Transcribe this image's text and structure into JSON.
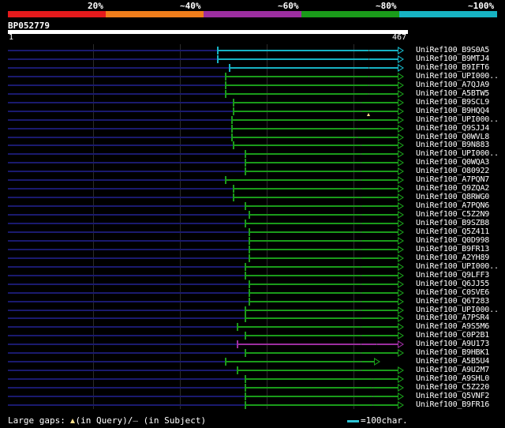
{
  "legend": [
    {
      "label": "20%",
      "color": "#e41a1c"
    },
    {
      "label": "~40%",
      "color": "#f07d1b"
    },
    {
      "label": "~60%",
      "color": "#9c2ea0"
    },
    {
      "label": "~80%",
      "color": "#1a9b1a"
    },
    {
      "label": "~100%",
      "color": "#17b3c3"
    }
  ],
  "query": {
    "id": "BP052779",
    "start": "1",
    "end": "467"
  },
  "colors": {
    "query_line": "#1a1a6e",
    "gap_marker": "#ffe08a",
    "ticks": "#555555"
  },
  "hits": [
    {
      "name": "UniRef100_B9S0A5",
      "start": 0.53,
      "identity": "~100%",
      "ticks": [
        0.91
      ]
    },
    {
      "name": "UniRef100_B9MTJ4",
      "start": 0.53,
      "identity": "~100%",
      "ticks": [
        0.91
      ]
    },
    {
      "name": "UniRef100_B9IFT6",
      "start": 0.56,
      "identity": "~100%",
      "ticks": [
        0.91
      ]
    },
    {
      "name": "UniRef100_UPI000..",
      "start": 0.55,
      "identity": "~80%",
      "ticks": [
        0.91
      ]
    },
    {
      "name": "UniRef100_A7QJA9",
      "start": 0.55,
      "identity": "~80%",
      "ticks": [
        0.91
      ]
    },
    {
      "name": "UniRef100_A5BTW5",
      "start": 0.55,
      "identity": "~80%",
      "ticks": [
        0.91
      ]
    },
    {
      "name": "UniRef100_B9SCL9",
      "start": 0.57,
      "identity": "~80%",
      "ticks": [
        0.89
      ]
    },
    {
      "name": "UniRef100_B9HQQ4",
      "start": 0.57,
      "identity": "~80%",
      "ticks": [
        0.89
      ],
      "gap_marker": 0.91
    },
    {
      "name": "UniRef100_UPI000..",
      "start": 0.565,
      "identity": "~80%",
      "ticks": [
        0.88
      ]
    },
    {
      "name": "UniRef100_Q9SJJ4",
      "start": 0.565,
      "identity": "~80%",
      "ticks": [
        0.88
      ]
    },
    {
      "name": "UniRef100_Q0WVL8",
      "start": 0.565,
      "identity": "~80%",
      "ticks": [
        0.88
      ]
    },
    {
      "name": "UniRef100_B9N883",
      "start": 0.57,
      "identity": "~80%",
      "ticks": [
        0.89
      ]
    },
    {
      "name": "UniRef100_UPI000..",
      "start": 0.6,
      "identity": "~80%",
      "ticks": [
        0.89
      ]
    },
    {
      "name": "UniRef100_Q0WQA3",
      "start": 0.6,
      "identity": "~80%",
      "ticks": [
        0.89
      ]
    },
    {
      "name": "UniRef100_O80922",
      "start": 0.6,
      "identity": "~80%",
      "ticks": [
        0.89
      ]
    },
    {
      "name": "UniRef100_A7PQN7",
      "start": 0.55,
      "identity": "~80%",
      "ticks": [
        0.89
      ]
    },
    {
      "name": "UniRef100_Q9ZQA2",
      "start": 0.57,
      "identity": "~80%",
      "ticks": [
        0.89
      ]
    },
    {
      "name": "UniRef100_Q8RWG0",
      "start": 0.57,
      "identity": "~80%",
      "ticks": [
        0.89
      ]
    },
    {
      "name": "UniRef100_A7PQN6",
      "start": 0.6,
      "identity": "~80%",
      "ticks": [
        0.89
      ]
    },
    {
      "name": "UniRef100_C5Z2N9",
      "start": 0.61,
      "identity": "~80%",
      "ticks": [
        0.89
      ]
    },
    {
      "name": "UniRef100_B9SZB8",
      "start": 0.6,
      "identity": "~80%",
      "ticks": [
        0.89
      ]
    },
    {
      "name": "UniRef100_Q5Z411",
      "start": 0.61,
      "identity": "~80%",
      "ticks": [
        0.89
      ]
    },
    {
      "name": "UniRef100_Q0D998",
      "start": 0.61,
      "identity": "~80%",
      "ticks": [
        0.89
      ]
    },
    {
      "name": "UniRef100_B9FR13",
      "start": 0.61,
      "identity": "~80%",
      "ticks": [
        0.89
      ]
    },
    {
      "name": "UniRef100_A2YH89",
      "start": 0.61,
      "identity": "~80%",
      "ticks": [
        0.89
      ]
    },
    {
      "name": "UniRef100_UPI000..",
      "start": 0.6,
      "identity": "~80%",
      "ticks": [
        0.89
      ]
    },
    {
      "name": "UniRef100_Q9LFF3",
      "start": 0.6,
      "identity": "~80%",
      "ticks": [
        0.89
      ]
    },
    {
      "name": "UniRef100_Q6JJ55",
      "start": 0.61,
      "identity": "~80%",
      "ticks": [
        0.89
      ]
    },
    {
      "name": "UniRef100_C0SVE6",
      "start": 0.61,
      "identity": "~80%",
      "ticks": [
        0.89
      ]
    },
    {
      "name": "UniRef100_Q6T283",
      "start": 0.61,
      "identity": "~80%",
      "ticks": [
        0.89
      ]
    },
    {
      "name": "UniRef100_UPI000..",
      "start": 0.6,
      "identity": "~80%",
      "ticks": [
        0.89
      ]
    },
    {
      "name": "UniRef100_A7PSR4",
      "start": 0.6,
      "identity": "~80%",
      "ticks": [
        0.89
      ]
    },
    {
      "name": "UniRef100_A9S5M6",
      "start": 0.58,
      "identity": "~80%",
      "ticks": [
        0.89
      ]
    },
    {
      "name": "UniRef100_C0P2B1",
      "start": 0.6,
      "identity": "~80%",
      "ticks": [
        0.89
      ]
    },
    {
      "name": "UniRef100_A9U173",
      "start": 0.58,
      "identity": "~60%",
      "ticks": [
        0.89,
        0.93
      ]
    },
    {
      "name": "UniRef100_B9HBK1",
      "start": 0.6,
      "identity": "~80%",
      "ticks": [
        0.89
      ]
    },
    {
      "name": "UniRef100_A5B5U4",
      "start": 0.55,
      "identity": "~80%",
      "ticks": [
        0.89
      ],
      "end": 0.94
    },
    {
      "name": "UniRef100_A9U2M7",
      "start": 0.58,
      "identity": "~80%",
      "ticks": [
        0.89
      ]
    },
    {
      "name": "UniRef100_A9SHL0",
      "start": 0.6,
      "identity": "~80%",
      "ticks": [
        0.92
      ]
    },
    {
      "name": "UniRef100_C5Z220",
      "start": 0.6,
      "identity": "~80%",
      "ticks": [
        0.92
      ]
    },
    {
      "name": "UniRef100_Q5VNF2",
      "start": 0.6,
      "identity": "~80%",
      "ticks": [
        0.92
      ]
    },
    {
      "name": "UniRef100_B9FR16",
      "start": 0.6,
      "identity": "~80%",
      "ticks": [
        0.92
      ]
    }
  ],
  "footer": {
    "large_gaps_label": "Large gaps:",
    "in_query_label": "(in Query)/",
    "in_subject_label": "(in Subject)",
    "scale_label": "=100char."
  }
}
